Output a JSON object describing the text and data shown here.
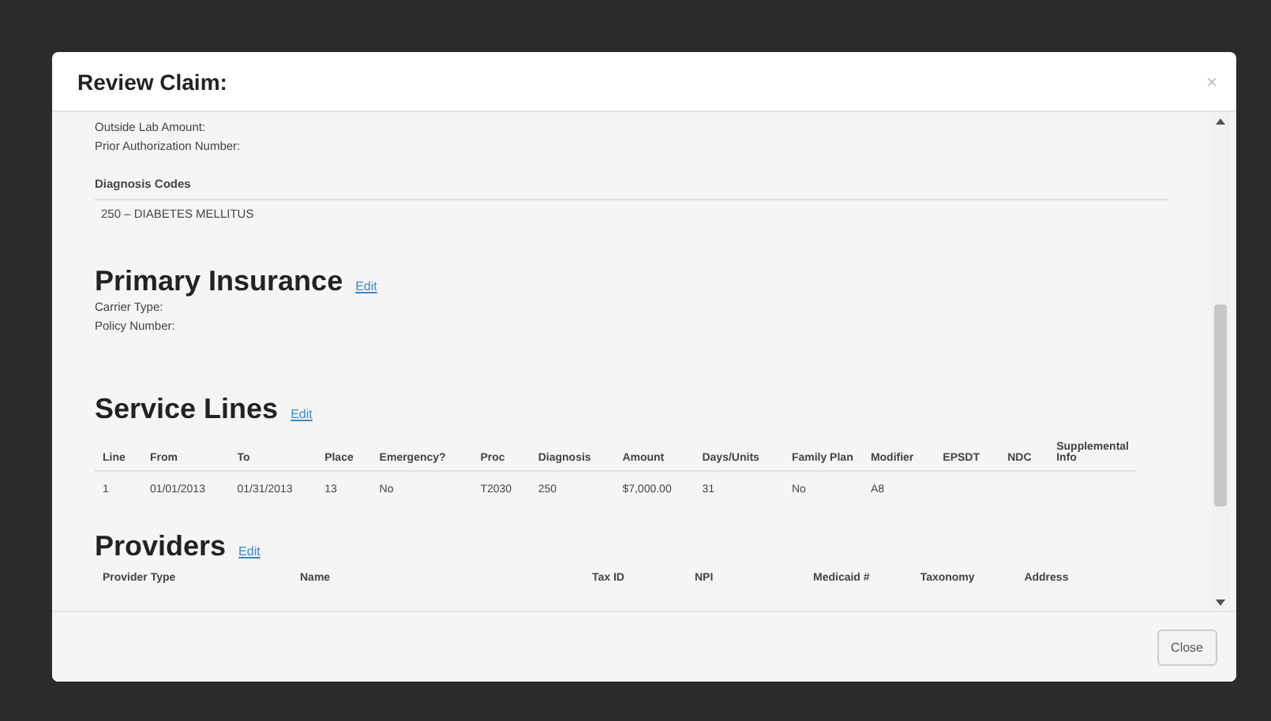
{
  "modal": {
    "title": "Review Claim:",
    "close_icon": "×"
  },
  "fields": [
    "Outside Lab Amount:",
    "Prior Authorization Number:"
  ],
  "diagnosis": {
    "heading": "Diagnosis Codes",
    "codes": [
      "250 – DIABETES MELLITUS"
    ]
  },
  "primary_insurance": {
    "heading": "Primary Insurance",
    "edit": "Edit",
    "fields": [
      "Carrier Type:",
      "Policy Number:"
    ]
  },
  "service_lines": {
    "heading": "Service Lines",
    "edit": "Edit",
    "columns": [
      "Line",
      "From",
      "To",
      "Place",
      "Emergency?",
      "Proc",
      "Diagnosis",
      "Amount",
      "Days/Units",
      "Family Plan",
      "Modifier",
      "EPSDT",
      "NDC",
      "Supplemental Info"
    ],
    "rows": [
      [
        "1",
        "01/01/2013",
        "01/31/2013",
        "13",
        "No",
        "T2030",
        "250",
        "$7,000.00",
        "31",
        "No",
        "A8"
      ]
    ]
  },
  "providers": {
    "heading": "Providers",
    "edit": "Edit",
    "columns": [
      "Provider Type",
      "Name",
      "Tax ID",
      "NPI",
      "Medicaid #",
      "Taxonomy",
      "Address"
    ]
  },
  "footer": {
    "button": "Close"
  }
}
